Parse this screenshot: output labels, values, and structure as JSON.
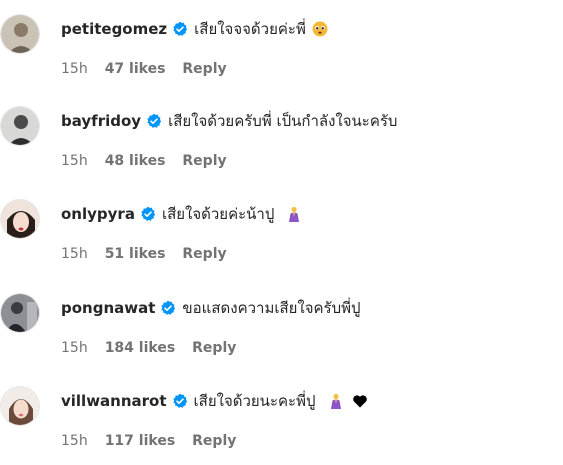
{
  "comments": [
    {
      "username": "petitegomez",
      "text": "เสียใจจจด้วยค่ะพี่",
      "time": "15h",
      "likes": "47 likes",
      "reply": "Reply",
      "emojis": [
        "pleading-face-icon"
      ],
      "verified_icon": "verified-badge-icon"
    },
    {
      "username": "bayfridoy",
      "text": "เสียใจด้วยครับพี่ เป็นกำลังใจนะครับ",
      "time": "15h",
      "likes": "48 likes",
      "reply": "Reply",
      "emojis": [],
      "verified_icon": "verified-badge-icon"
    },
    {
      "username": "onlypyra",
      "text": "เสียใจด้วยค่ะน้าปู",
      "time": "15h",
      "likes": "51 likes",
      "reply": "Reply",
      "emojis": [
        "praying-person-icon"
      ],
      "verified_icon": "verified-badge-icon"
    },
    {
      "username": "pongnawat",
      "text": "ขอแสดงความเสียใจครับพี่ปู",
      "time": "15h",
      "likes": "184 likes",
      "reply": "Reply",
      "emojis": [],
      "verified_icon": "verified-badge-icon"
    },
    {
      "username": "villwannarot",
      "text": "เสียใจด้วยนะคะพี่ปู",
      "time": "15h",
      "likes": "117 likes",
      "reply": "Reply",
      "emojis": [
        "praying-person-icon",
        "black-heart-icon"
      ],
      "verified_icon": "verified-badge-icon"
    }
  ],
  "colors": {
    "text": "#262626",
    "meta": "#737373",
    "verified": "#0095f6",
    "background": "#ffffff"
  }
}
